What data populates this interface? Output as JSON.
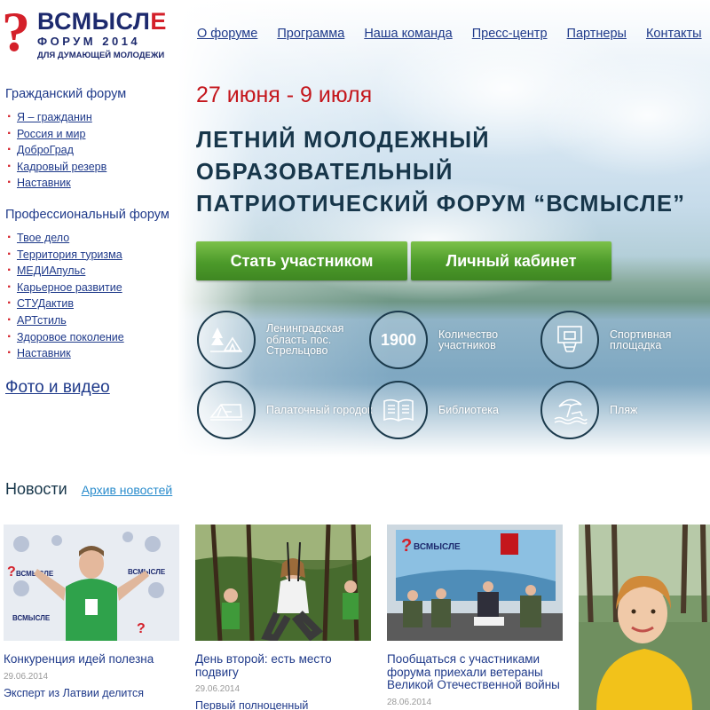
{
  "logo": {
    "mark": "?",
    "title_prefix": "ВСМЫСЛ",
    "title_suffix": "Е",
    "subtitle": "ФОРУМ 2014",
    "tagline": "ДЛЯ ДУМАЮЩЕЙ МОЛОДЕЖИ"
  },
  "nav": [
    "О форуме",
    "Программа",
    "Наша команда",
    "Пресс-центр",
    "Партнеры",
    "Контакты"
  ],
  "sidebar": {
    "civil_heading": "Гражданский форум",
    "civil_items": [
      "Я – гражданин",
      "Россия и мир",
      "ДоброГрад",
      "Кадровый резерв",
      "Наставник"
    ],
    "pro_heading": "Профессиональный форум",
    "pro_items": [
      "Твое дело",
      "Территория туризма",
      "МЕДИАпульс",
      "Карьерное развитие",
      "СТУДактив",
      "АРТстиль",
      "Здоровое поколение",
      "Наставник"
    ],
    "photo_video": "Фото и видео"
  },
  "hero": {
    "dates": "27 июня - 9 июля",
    "title_lines": [
      "ЛЕТНИЙ МОЛОДЕЖНЫЙ",
      "ОБРАЗОВАТЕЛЬНЫЙ",
      "ПАТРИОТИЧЕСКИЙ ФОРУМ “ВСМЫСЛЕ”"
    ],
    "join_button": "Стать участником",
    "cabinet_button": "Личный кабинет"
  },
  "features": [
    {
      "icon": "tent-trees-icon",
      "label": "Ленинградская область пос. Стрельцово"
    },
    {
      "icon": "number",
      "number": "1900",
      "label": "Количество участников"
    },
    {
      "icon": "basketball-hoop-icon",
      "label": "Спортивная площадка"
    },
    {
      "icon": "tent-icon",
      "label": "Палаточный городок"
    },
    {
      "icon": "book-icon",
      "label": "Библиотека"
    },
    {
      "icon": "beach-umbrella-icon",
      "label": "Пляж"
    }
  ],
  "news": {
    "heading": "Новости",
    "archive_link": "Архив новостей",
    "items": [
      {
        "title": "Конкуренция идей полезна",
        "date": "29.06.2014",
        "next": "Эксперт из Латвии делится"
      },
      {
        "title": "День второй: есть место подвигу",
        "date": "29.06.2014",
        "next": "Первый полноценный"
      },
      {
        "title": "Пообщаться с участниками форума приехали ветераны Великой Отечественной войны",
        "date": "28.06.2014",
        "next": ""
      },
      {
        "title": "",
        "date": "",
        "next": ""
      }
    ]
  },
  "colors": {
    "brand_red": "#d4202a",
    "brand_navy": "#1d2a6e",
    "link": "#1f3a8a",
    "button_green": "#4c9a2a",
    "hero_title": "#17364a"
  }
}
